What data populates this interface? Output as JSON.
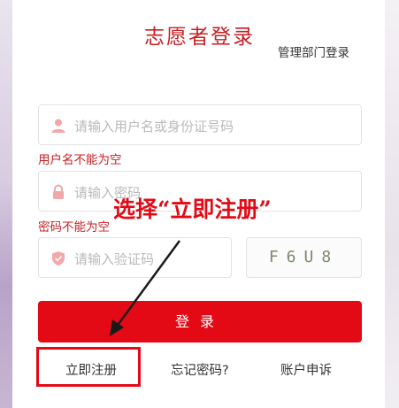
{
  "header": {
    "title": "志愿者登录",
    "manager_login": "管理部门登录"
  },
  "form": {
    "username_placeholder": "请输入用户名或身份证号码",
    "username_error": "用户名不能为空",
    "password_placeholder": "请输入密码",
    "password_error": "密码不能为空",
    "captcha_placeholder": "请输入验证码",
    "captcha_code": "F6U8",
    "login_button": "登录"
  },
  "links": {
    "register": "立即注册",
    "forgot_password": "忘记密码?",
    "account_appeal": "账户申诉"
  },
  "annotation": {
    "text": "选择“立即注册”",
    "color": "#e30a16"
  },
  "colors": {
    "accent": "#c81e22",
    "button": "#e30a16",
    "icon": "#f2a7aa"
  },
  "icons": {
    "username": "user-icon",
    "password": "lock-icon",
    "captcha": "shield-icon"
  }
}
